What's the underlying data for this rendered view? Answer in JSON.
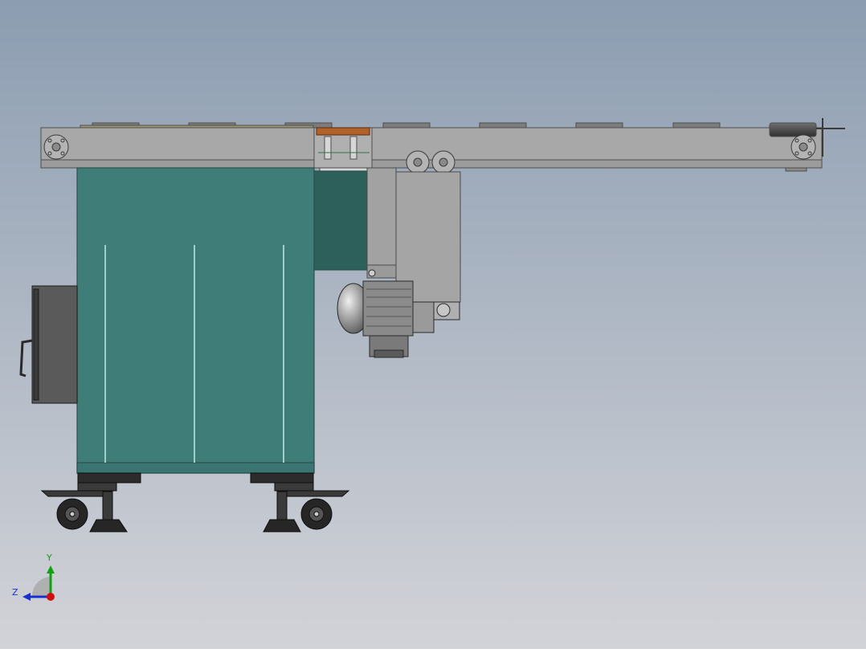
{
  "scene": {
    "background_top": "#8c9db1",
    "background_bottom": "#d2d3d8",
    "cabinet_color": "#3f7d78",
    "cabinet_dark": "#2d5f5b",
    "frame_color": "#a6a6a6",
    "frame_edge": "#5a5a5a",
    "housing_color": "#9e9e9e",
    "motor_color": "#8a8a8a",
    "wheel_color": "#2a2a2a",
    "accent_orange": "#b0622a"
  },
  "triad": {
    "x_color": "#d01010",
    "y_color": "#10a010",
    "z_color": "#1830d0",
    "y_label": "Y",
    "z_label": "Z"
  }
}
